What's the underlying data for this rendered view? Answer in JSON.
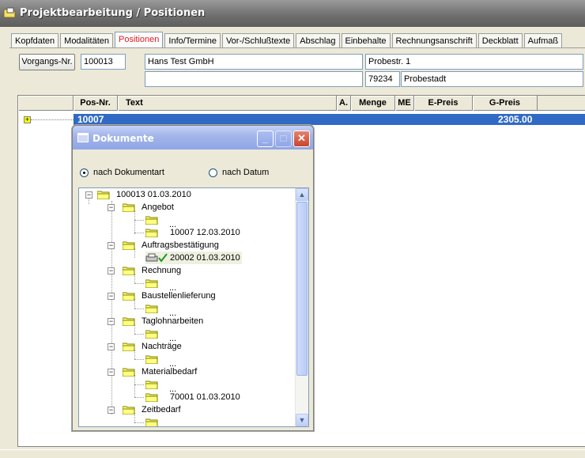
{
  "window": {
    "title": "Projektbearbeitung / Positionen"
  },
  "tabs": [
    {
      "label": "Kopfdaten",
      "active": false
    },
    {
      "label": "Modalitäten",
      "active": false
    },
    {
      "label": "Positionen",
      "active": true
    },
    {
      "label": "Info/Termine",
      "active": false
    },
    {
      "label": "Vor-/Schlußtexte",
      "active": false
    },
    {
      "label": "Abschlag",
      "active": false
    },
    {
      "label": "Einbehalte",
      "active": false
    },
    {
      "label": "Rechnungsanschrift",
      "active": false
    },
    {
      "label": "Deckblatt",
      "active": false
    },
    {
      "label": "Aufmaß",
      "active": false
    }
  ],
  "header": {
    "vorgang_button": "Vorgangs-Nr.",
    "vorgang_nr": "100013",
    "name": "Hans Test GmbH",
    "name2": "",
    "street": "Probestr. 1",
    "zip": "79234",
    "city": "Probestadt"
  },
  "grid": {
    "columns": [
      "",
      "Pos-Nr.",
      "Text",
      "A.",
      "Menge",
      "ME",
      "E-Preis",
      "G-Preis"
    ],
    "rows": [
      {
        "pos_nr": "10007",
        "g_preis": "2305.00",
        "expander": "+"
      }
    ]
  },
  "dialog": {
    "title": "Dokumente",
    "radio_by_type": "nach Dokumentart",
    "radio_by_date": "nach Datum",
    "selected": "nach Dokumentart",
    "tree": {
      "root": "100013 01.03.2010",
      "groups": [
        {
          "label": "Angebot",
          "children": [
            "...",
            "10007 12.03.2010"
          ]
        },
        {
          "label": "Auftragsbestätigung",
          "children": [
            "20002 01.03.2010"
          ]
        },
        {
          "label": "Rechnung",
          "children": [
            "..."
          ]
        },
        {
          "label": "Baustellenlieferung",
          "children": [
            "..."
          ]
        },
        {
          "label": "Taglohnarbeiten",
          "children": [
            "..."
          ]
        },
        {
          "label": "Nachträge",
          "children": [
            "..."
          ]
        },
        {
          "label": "Materialbedarf",
          "children": [
            "...",
            "70001 01.03.2010"
          ]
        },
        {
          "label": "Zeitbedarf",
          "children": [
            "..."
          ]
        }
      ]
    }
  },
  "colors": {
    "selection": "#316ac5",
    "active_tab_text": "#e02020",
    "folder": "#ffff80"
  }
}
